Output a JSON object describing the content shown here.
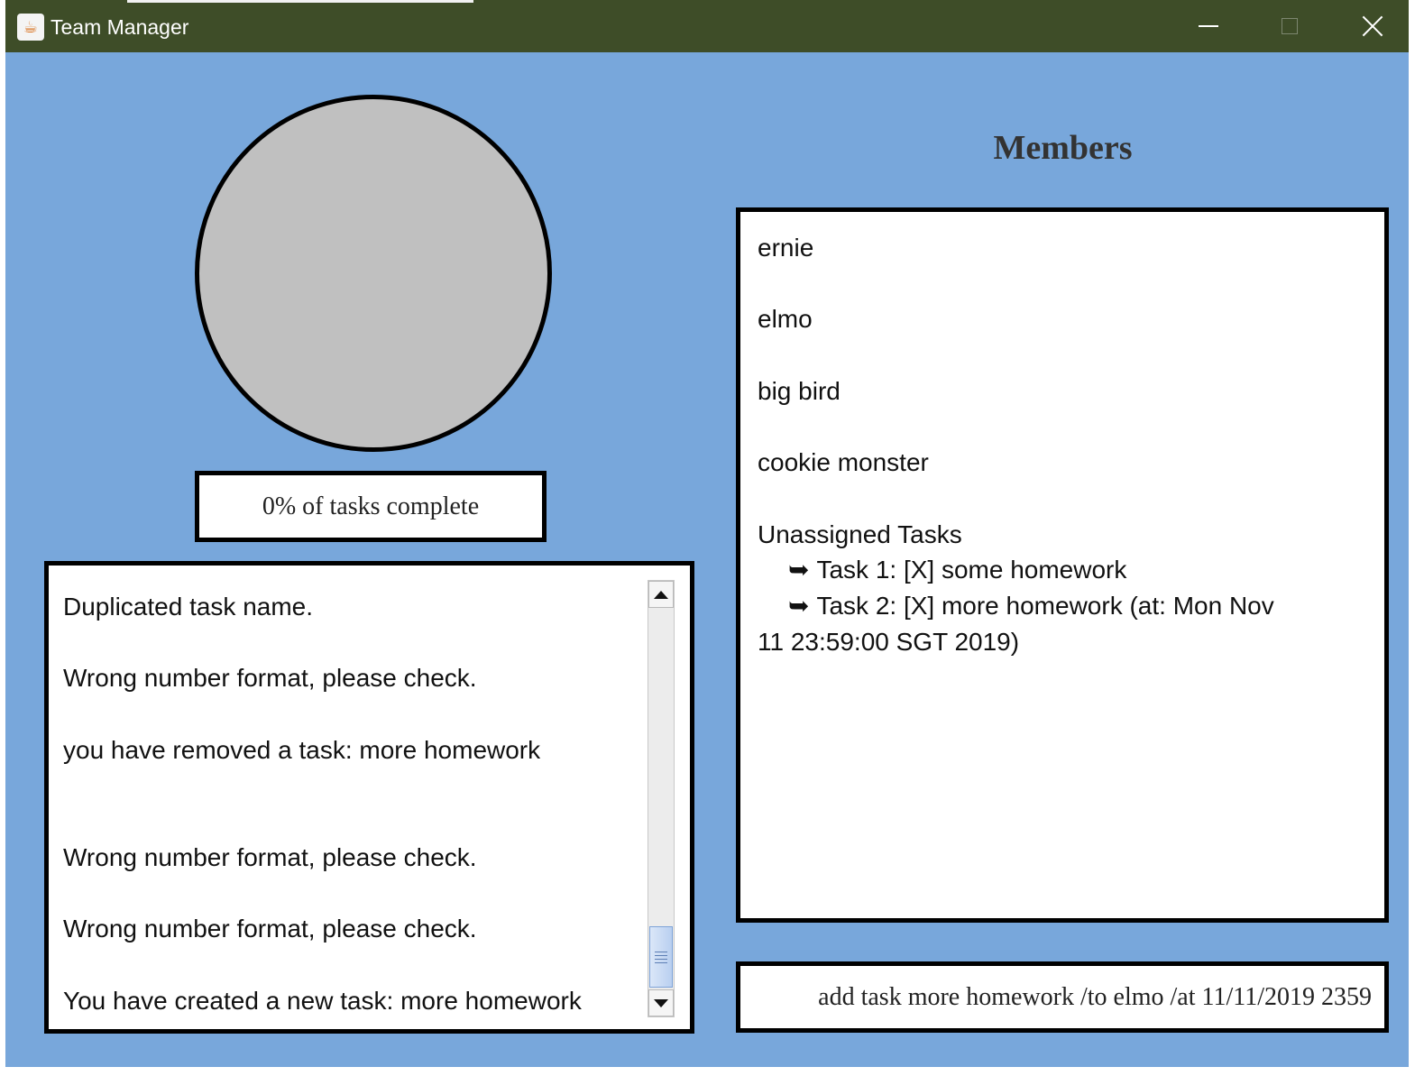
{
  "window": {
    "title": "Team Manager",
    "icon": "java-icon",
    "controls": [
      "minimize-icon",
      "maximize-icon",
      "close-icon"
    ]
  },
  "progress": {
    "fraction_complete": 0,
    "label": "0% of tasks complete"
  },
  "log": {
    "messages": [
      "Duplicated task name.",
      "Wrong number format, please check.",
      "you have removed a task: more homework",
      "",
      "Wrong number format, please check.",
      "Wrong number format, please check.",
      "You have created a new task: more homework"
    ]
  },
  "members": {
    "heading": "Members",
    "names": [
      "ernie",
      "elmo",
      "big bird",
      "cookie monster"
    ],
    "unassigned_title": "Unassigned Tasks",
    "tasks": [
      {
        "arrow": "➥",
        "text": "Task 1: [X] some homework"
      },
      {
        "arrow": "➥",
        "text": "Task 2: [X] more homework (at: Mon Nov"
      }
    ],
    "task2_continuation": "11 23:59:00 SGT 2019)"
  },
  "command": {
    "value": "add task more homework /to elmo /at 11/11/2019 2359"
  },
  "colors": {
    "background": "#78A7DB",
    "titlebar": "#3E4D28",
    "progress_fill": "#C0C0C0"
  }
}
